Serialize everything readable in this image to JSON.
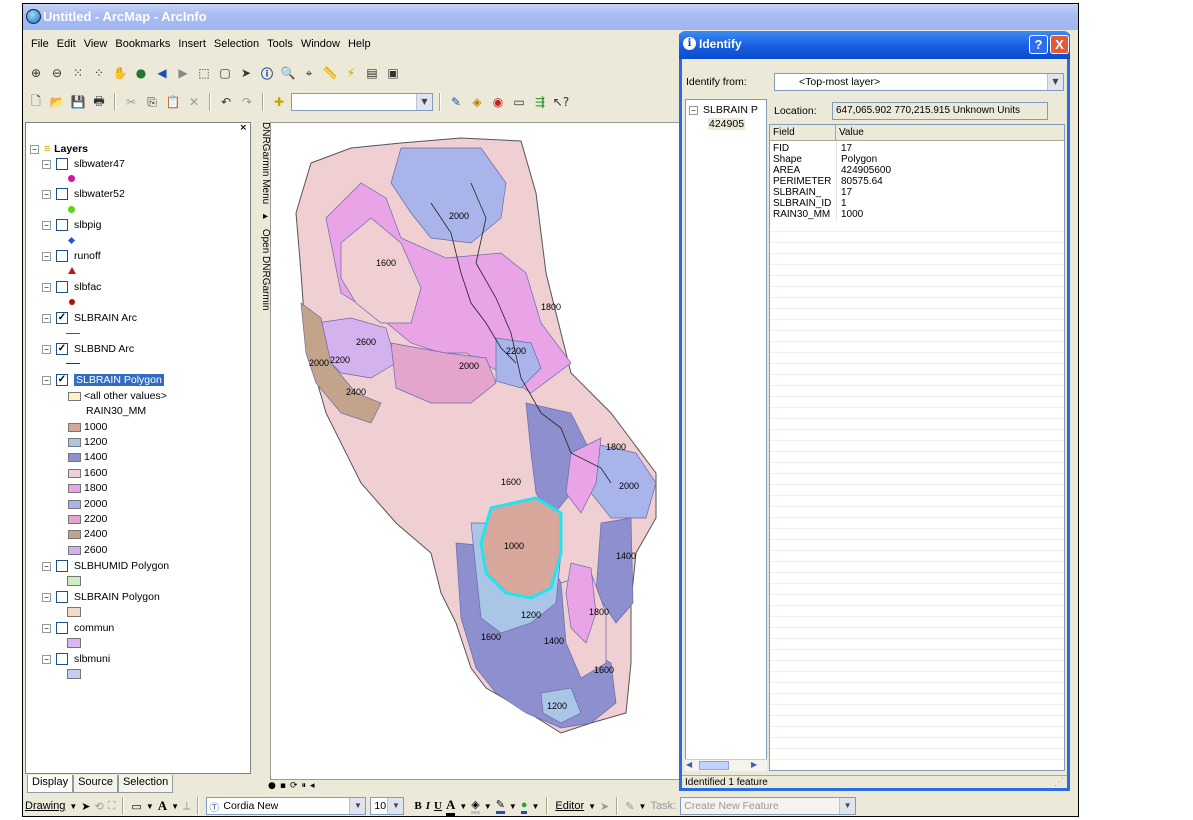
{
  "window": {
    "title": "Untitled - ArcMap - ArcInfo"
  },
  "menu": [
    "File",
    "Edit",
    "View",
    "Bookmarks",
    "Insert",
    "Selection",
    "Tools",
    "Window",
    "Help"
  ],
  "toc": {
    "root_label": "Layers",
    "layers": [
      {
        "name": "slbwater47",
        "checked": false,
        "symbol": "circle",
        "color": "#d4149a"
      },
      {
        "name": "slbwater52",
        "checked": false,
        "symbol": "circle",
        "color": "#5fd11a"
      },
      {
        "name": "slbpig",
        "checked": false,
        "symbol": "diamond",
        "color": "#2657c9"
      },
      {
        "name": "runoff",
        "checked": false,
        "symbol": "triangle",
        "color": "#c01818"
      },
      {
        "name": "slbfac",
        "checked": false,
        "symbol": "circle",
        "color": "#b01010"
      },
      {
        "name": "SLBRAIN Arc",
        "checked": true,
        "symbol": "line",
        "color": "#4a4a9a"
      },
      {
        "name": "SLBBND Arc",
        "checked": true,
        "symbol": "line",
        "color": "#333333"
      },
      {
        "name": "SLBRAIN Polygon",
        "checked": true,
        "symbol": "legend",
        "color": ""
      },
      {
        "name": "SLBHUMID Polygon",
        "checked": false,
        "symbol": "box",
        "color": "#c9efc3"
      },
      {
        "name": "SLBRAIN Polygon",
        "checked": false,
        "symbol": "box",
        "color": "#f2d9cc"
      },
      {
        "name": "commun",
        "checked": false,
        "symbol": "box",
        "color": "#d9b8f0"
      },
      {
        "name": "slbmuni",
        "checked": false,
        "symbol": "box",
        "color": "#c7cdee"
      }
    ],
    "legend": {
      "other_label": "<all other values>",
      "other_color": "#fdf3c9",
      "field": "RAIN30_MM",
      "classes": [
        {
          "value": "1000",
          "color": "#d6a79a"
        },
        {
          "value": "1200",
          "color": "#a9c6e6"
        },
        {
          "value": "1400",
          "color": "#8e8fcf"
        },
        {
          "value": "1600",
          "color": "#efcfd1"
        },
        {
          "value": "1800",
          "color": "#e8a4e6"
        },
        {
          "value": "2000",
          "color": "#a9b4ea"
        },
        {
          "value": "2200",
          "color": "#e3a5cc"
        },
        {
          "value": "2400",
          "color": "#c3a48b"
        },
        {
          "value": "2600",
          "color": "#d4b2ee"
        }
      ]
    },
    "tabs": [
      "Display",
      "Source",
      "Selection"
    ]
  },
  "dnr": {
    "menu": "DNRGarmin Menu",
    "open": "Open DNRGarmin"
  },
  "map_labels": [
    "2000",
    "1600",
    "1800",
    "2600",
    "2200",
    "2000",
    "2000",
    "2200",
    "2400",
    "1800",
    "1600",
    "2000",
    "1000",
    "1400",
    "1200",
    "1800",
    "1600",
    "1400",
    "1600",
    "1200"
  ],
  "identify": {
    "title": "Identify",
    "help_btn": "?",
    "close_btn": "X",
    "from_label": "Identify from:",
    "from_value": "<Top-most layer>",
    "tree_layer": "SLBRAIN P",
    "tree_item": "424905",
    "location_label": "Location:",
    "location_value": "647,065.902  770,215.915 Unknown Units",
    "col_field": "Field",
    "col_value": "Value",
    "rows": [
      {
        "field": "FID",
        "value": "17"
      },
      {
        "field": "Shape",
        "value": "Polygon"
      },
      {
        "field": "AREA",
        "value": "424905600"
      },
      {
        "field": "PERIMETER",
        "value": "80575.64"
      },
      {
        "field": "SLBRAIN_",
        "value": "17"
      },
      {
        "field": "SLBRAIN_ID",
        "value": "1"
      },
      {
        "field": "RAIN30_MM",
        "value": "1000"
      }
    ],
    "status": "Identified 1 feature"
  },
  "drawing": {
    "drawing_label": "Drawing",
    "font_name": "Cordia New",
    "font_size": "10",
    "editor_label": "Editor",
    "task_label": "Task:",
    "task_value": "Create New Feature"
  }
}
